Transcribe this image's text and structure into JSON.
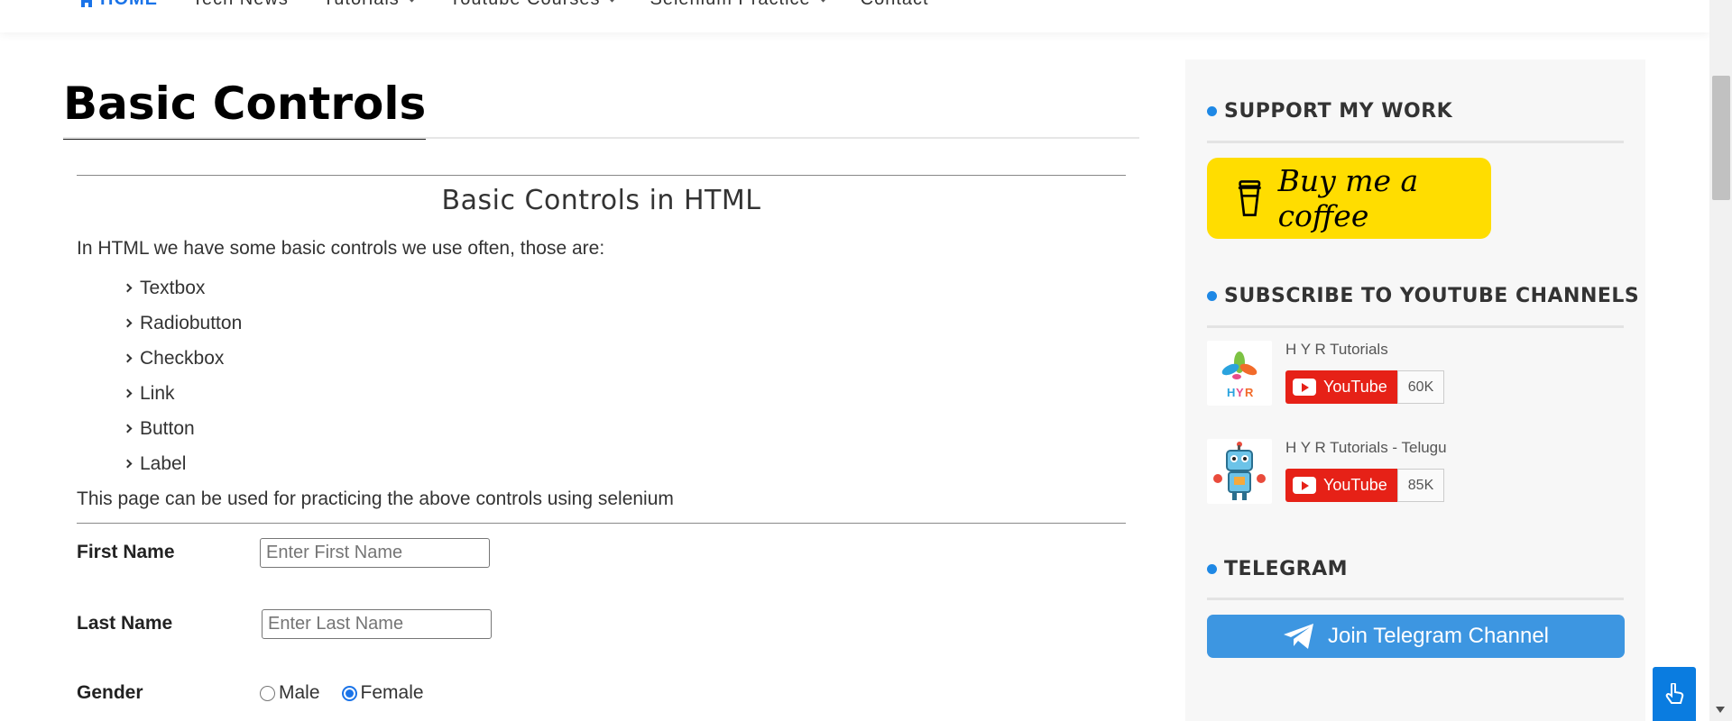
{
  "nav": {
    "items": [
      {
        "label": "HOME",
        "active": true
      },
      {
        "label": "Tech News",
        "active": false
      },
      {
        "label": "Tutorials",
        "active": false,
        "dropdown": true
      },
      {
        "label": "Youtube Courses",
        "active": false,
        "dropdown": true
      },
      {
        "label": "Selenium Practice",
        "active": false,
        "dropdown": true
      },
      {
        "label": "Contact",
        "active": false
      }
    ]
  },
  "page": {
    "title": "Basic Controls",
    "section_heading": "Basic Controls in HTML",
    "intro": "In HTML we have some basic controls we use often, those are:",
    "controls": [
      "Textbox",
      "Radiobutton",
      "Checkbox",
      "Link",
      "Button",
      "Label"
    ],
    "note": "This page can be used for practicing the above controls using selenium"
  },
  "form": {
    "first_name": {
      "label": "First Name",
      "placeholder": "Enter First Name",
      "value": ""
    },
    "last_name": {
      "label": "Last Name",
      "placeholder": "Enter Last Name",
      "value": ""
    },
    "gender": {
      "label": "Gender",
      "options": [
        {
          "label": "Male",
          "checked": false
        },
        {
          "label": "Female",
          "checked": true
        }
      ]
    }
  },
  "sidebar": {
    "support_title": "SUPPORT MY WORK",
    "coffee_label": "Buy me a coffee",
    "subscribe_title": "SUBSCRIBE TO YOUTUBE CHANNELS",
    "channels": [
      {
        "name": "H Y R Tutorials",
        "button": "YouTube",
        "count": "60K"
      },
      {
        "name": "H Y R Tutorials - Telugu",
        "button": "YouTube",
        "count": "85K"
      }
    ],
    "telegram_title": "TELEGRAM",
    "telegram_button": "Join Telegram Channel"
  },
  "colors": {
    "accent": "#1a73e8",
    "coffee_yellow": "#ffdd00",
    "youtube_red": "#e62117",
    "telegram_blue": "#3d96e1"
  }
}
